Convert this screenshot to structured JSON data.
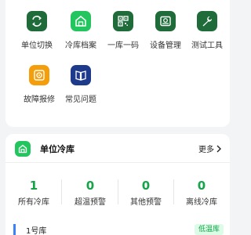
{
  "grid": {
    "items": [
      {
        "label": "单位切换",
        "icon": "switch-unit-icon"
      },
      {
        "label": "冷库档案",
        "icon": "cold-storage-archive-icon"
      },
      {
        "label": "一库一码",
        "icon": "qr-code-icon"
      },
      {
        "label": "设备管理",
        "icon": "device-management-icon"
      },
      {
        "label": "测试工具",
        "icon": "wrench-icon"
      },
      {
        "label": "故障报修",
        "icon": "repair-icon"
      },
      {
        "label": "常见问题",
        "icon": "book-icon"
      }
    ]
  },
  "section": {
    "title": "单位冷库",
    "more_label": "更多"
  },
  "stats": [
    {
      "value": "1",
      "label": "所有冷库"
    },
    {
      "value": "0",
      "label": "超温预警"
    },
    {
      "value": "0",
      "label": "其他预警"
    },
    {
      "value": "0",
      "label": "离线冷库"
    }
  ],
  "list": [
    {
      "name": "1号库",
      "badge": "低温库"
    }
  ],
  "colors": {
    "accent": "#16a34a",
    "icon_dark_green": "#1f6b3a",
    "icon_bright_green": "#22c55e",
    "icon_orange": "#f59e0b",
    "icon_navy": "#1e3a8a",
    "list_bar": "#3b82f6"
  }
}
